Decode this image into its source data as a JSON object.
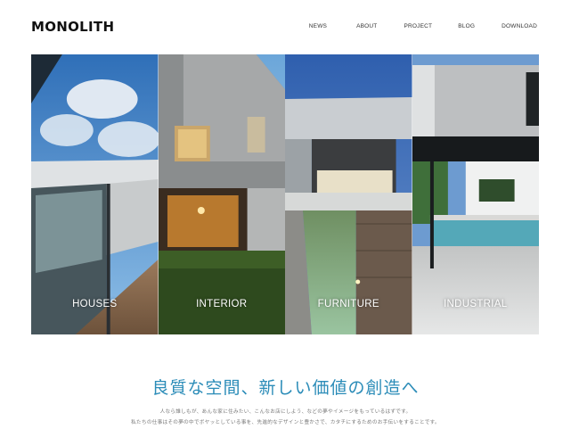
{
  "brand": {
    "logo": "MONOLITH"
  },
  "nav": {
    "items": [
      "NEWS",
      "ABOUT",
      "PROJECT",
      "BLOG",
      "DOWNLOAD"
    ]
  },
  "gallery": {
    "panels": [
      {
        "label": "HOUSES"
      },
      {
        "label": "INTERIOR"
      },
      {
        "label": "FURNITURE"
      },
      {
        "label": "INDUSTRIAL"
      }
    ]
  },
  "intro": {
    "headline": "良質な空間、新しい価値の創造へ",
    "line1": "人なら誰しもが、あんな家に住みたい、こんなお店にしよう、などの夢やイメージをもっているはずです。",
    "line2": "私たちの仕事はその夢の中でボヤッとしている事を、先進的なデザインと豊かさで、カタチにするためのお手伝いをすることです。"
  },
  "colors": {
    "accent": "#2b8cb8",
    "logo": "#111111",
    "text_muted": "#777777"
  }
}
